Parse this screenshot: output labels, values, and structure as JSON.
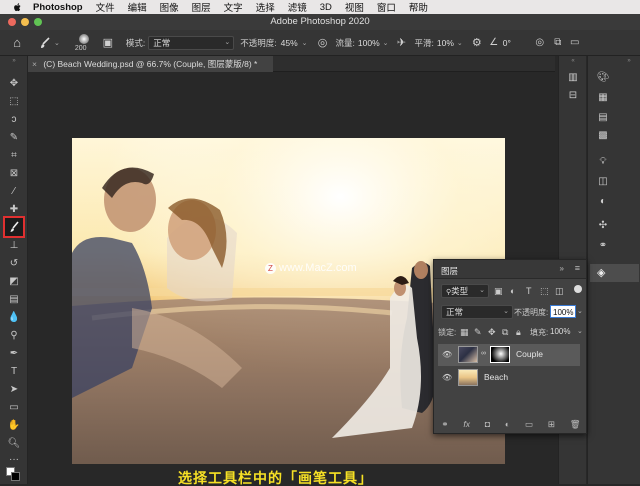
{
  "menubar": {
    "app": "Photoshop",
    "items": [
      "文件",
      "编辑",
      "图像",
      "图层",
      "文字",
      "选择",
      "滤镜",
      "3D",
      "视图",
      "窗口",
      "帮助"
    ]
  },
  "window": {
    "title": "Adobe Photoshop 2020"
  },
  "options": {
    "brush_size": "200",
    "mode_label": "模式:",
    "mode_value": "正常",
    "opacity_label": "不透明度:",
    "opacity_value": "45%",
    "flow_label": "流量:",
    "flow_value": "100%",
    "smooth_label": "平滑:",
    "smooth_value": "10%",
    "angle_value": "0°"
  },
  "document": {
    "tab_title": "(C) Beach Wedding.psd @ 66.7% (Couple, 图层蒙版/8) *"
  },
  "watermark": "www.MacZ.com",
  "layers_panel": {
    "title": "图层",
    "filter_label": "类型",
    "blend_mode": "正常",
    "opacity_label": "不透明度:",
    "opacity_value": "100%",
    "lock_label": "锁定:",
    "fill_label": "填充:",
    "fill_value": "100%",
    "layers": [
      {
        "name": "Couple",
        "selected": true
      },
      {
        "name": "Beach",
        "selected": false
      }
    ],
    "footer_icons": [
      "link-icon",
      "fx-icon",
      "mask-icon",
      "adjustment-icon",
      "group-icon",
      "new-layer-icon",
      "trash-icon"
    ]
  },
  "caption": "选择工具栏中的「画笔工具」",
  "colors": {
    "accent_red": "#e03030",
    "caption_yellow": "#f6e025"
  }
}
